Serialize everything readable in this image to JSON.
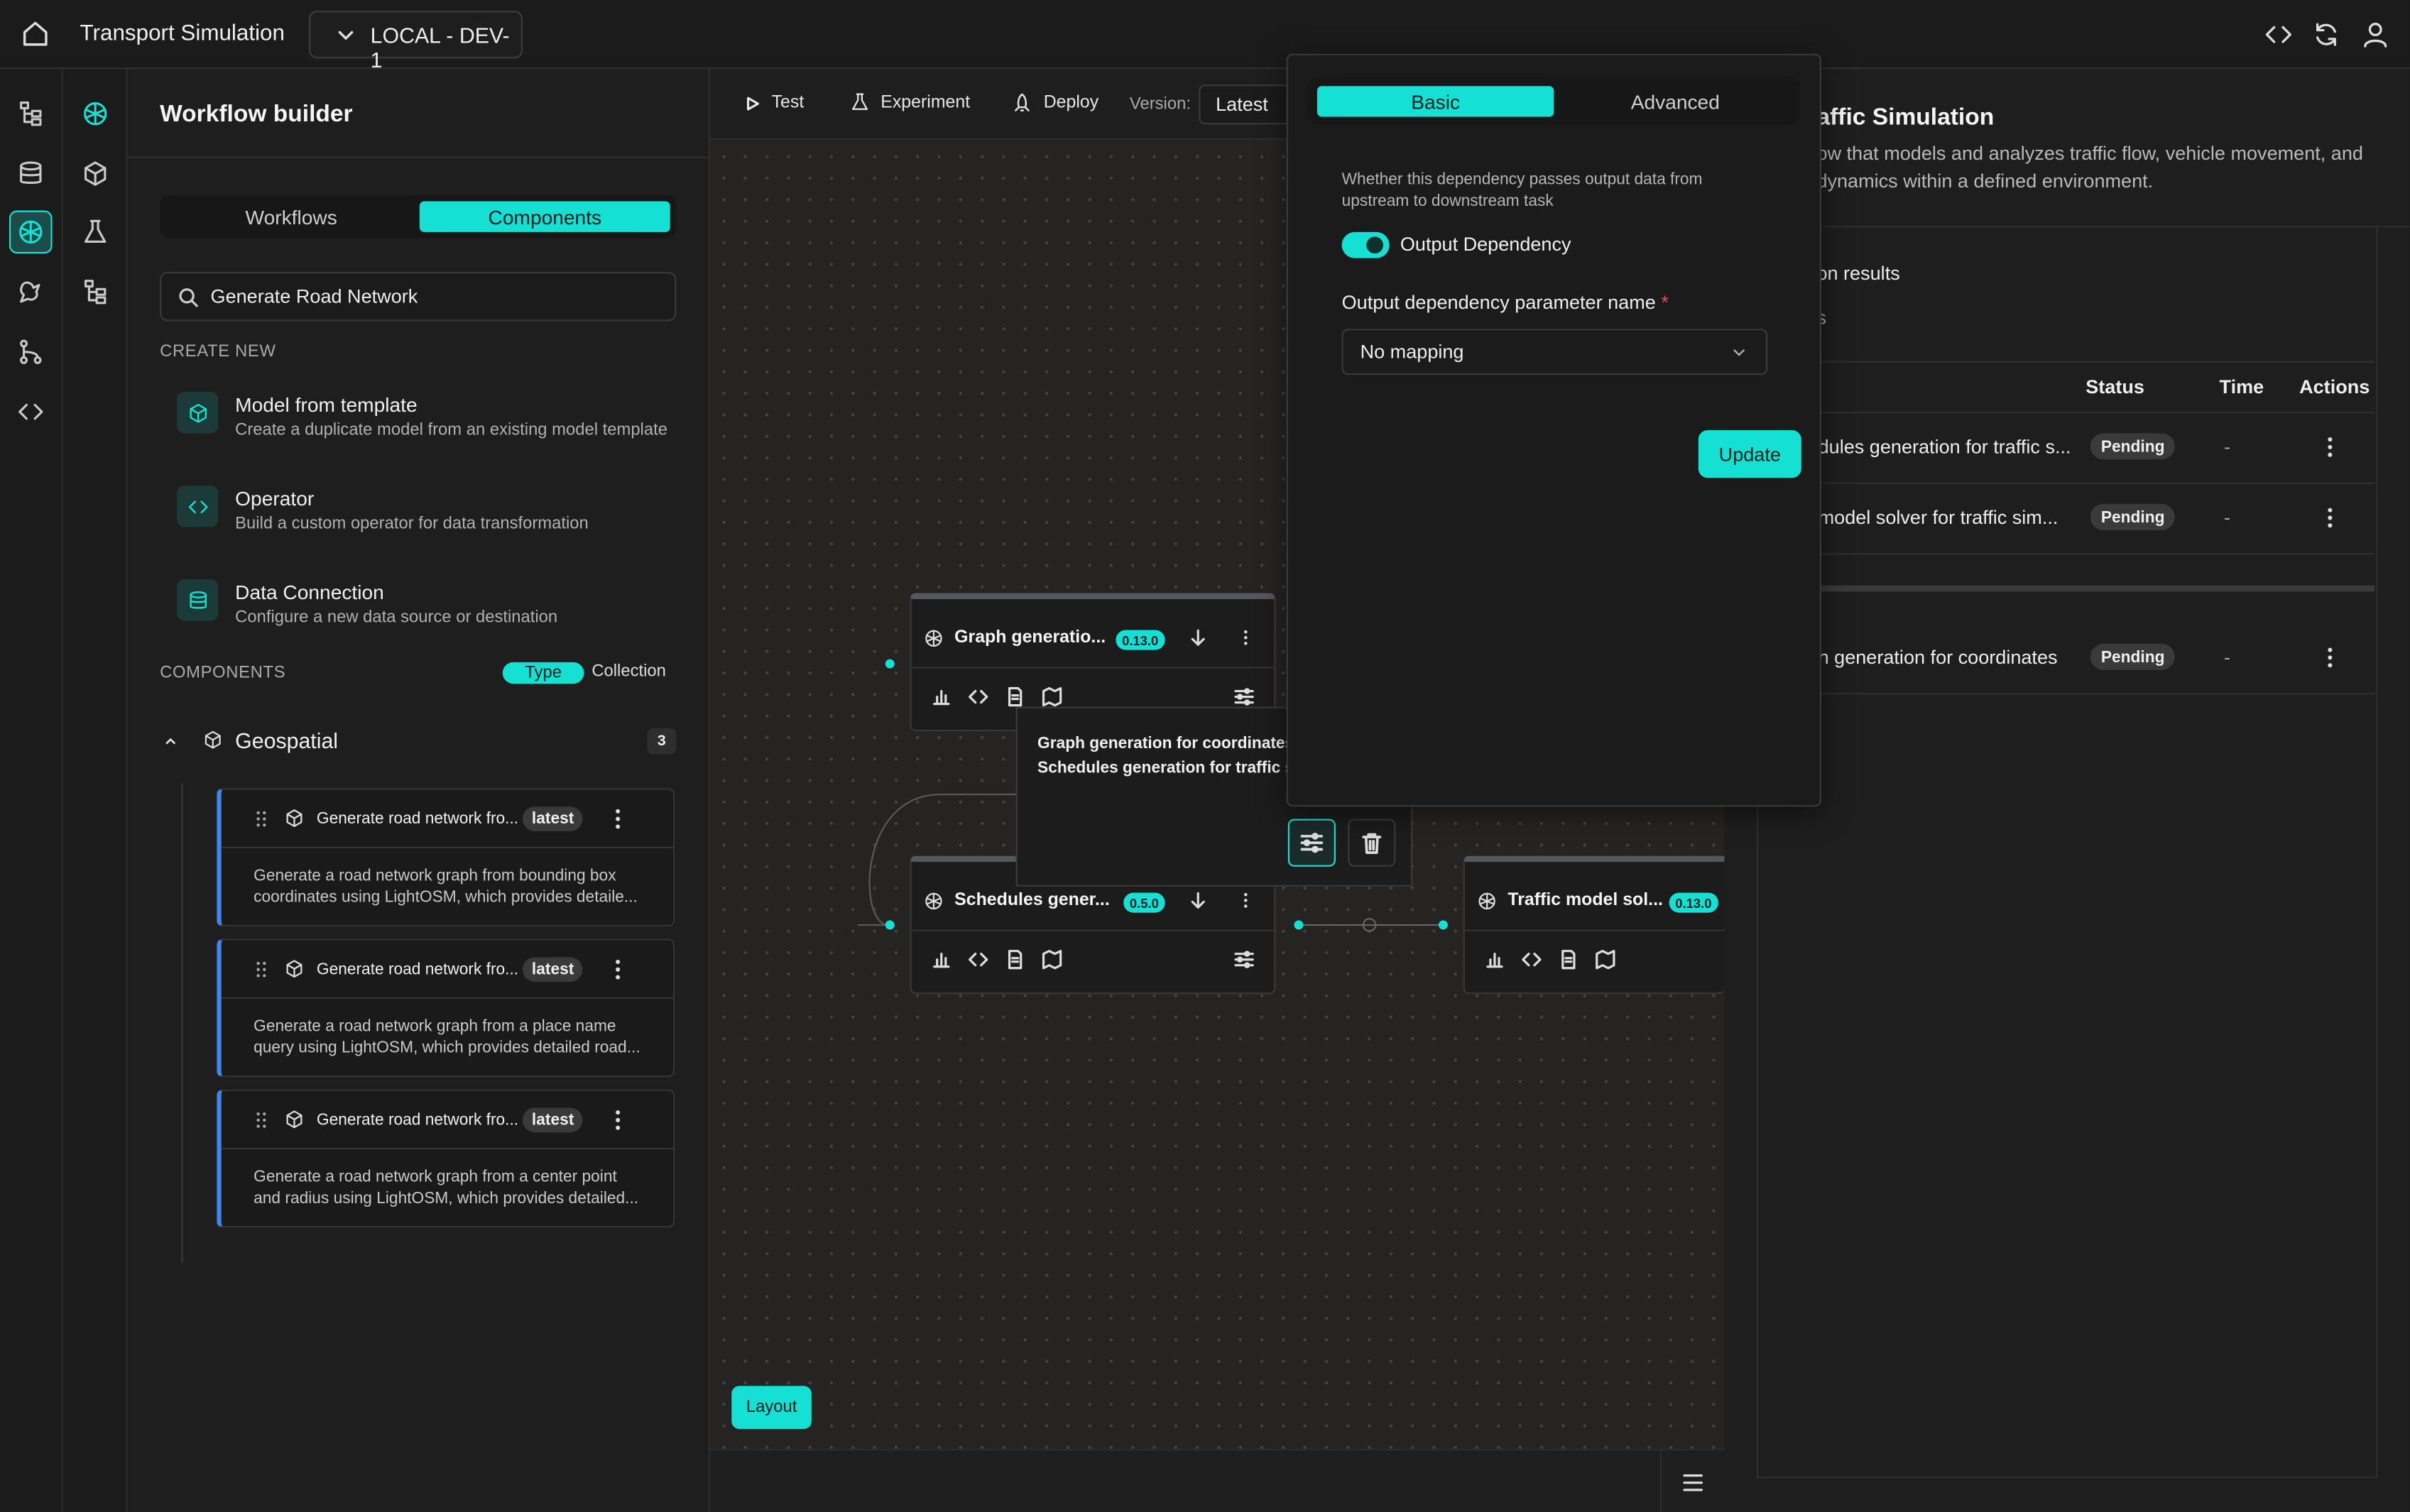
{
  "header": {
    "app_title": "Transport Simulation",
    "environment": "LOCAL - DEV-1"
  },
  "left_panel": {
    "title": "Workflow builder",
    "tabs": [
      "Workflows",
      "Components"
    ],
    "active_tab": "Components",
    "search_value": "Generate Road Network",
    "create_new_label": "CREATE NEW",
    "create_items": [
      {
        "title": "Model from template",
        "subtitle": "Create a duplicate model from an existing model template",
        "icon": "cube-icon"
      },
      {
        "title": "Operator",
        "subtitle": "Build a custom operator for data transformation",
        "icon": "code-icon"
      },
      {
        "title": "Data Connection",
        "subtitle": "Configure a new data source or destination",
        "icon": "database-icon"
      }
    ],
    "components_label": "COMPONENTS",
    "grouping_toggle": [
      "Type",
      "Collection"
    ],
    "group": {
      "name": "Geospatial",
      "count": "3"
    },
    "cards": [
      {
        "title": "Generate road network fro...",
        "badge": "latest",
        "desc1": "Generate a road network graph from bounding box",
        "desc2": "coordinates using LightOSM, which provides detaile..."
      },
      {
        "title": "Generate road network fro...",
        "badge": "latest",
        "desc1": "Generate a road network graph from a place name",
        "desc2": "query using LightOSM, which provides detailed road..."
      },
      {
        "title": "Generate road network fro...",
        "badge": "latest",
        "desc1": "Generate a road network graph from a center point",
        "desc2": "and radius using LightOSM, which provides detailed..."
      }
    ]
  },
  "canvas": {
    "toolbar": {
      "test": "Test",
      "experiment": "Experiment",
      "deploy": "Deploy",
      "version_label": "Version:",
      "version_value": "Latest"
    },
    "nodes": [
      {
        "title": "Graph generatio...",
        "version": "0.13.0"
      },
      {
        "title": "Schedules gener...",
        "version": "0.5.0"
      },
      {
        "title": "Traffic model sol...",
        "version": "0.13.0"
      }
    ],
    "tooltip_lines": [
      "Graph generation for coordinates",
      "Schedules generation for traffic s"
    ],
    "layout_button": "Layout"
  },
  "popover": {
    "tabs": [
      "Basic",
      "Advanced"
    ],
    "active_tab": "Basic",
    "help_text_1": "Whether this dependency passes output data from",
    "help_text_2": "upstream to downstream task",
    "toggle_label": "Output Dependency",
    "toggle_on": true,
    "param_label": "Output dependency parameter name",
    "required_mark": "*",
    "select_value": "No mapping",
    "update_button": "Update"
  },
  "right_panel": {
    "title": "affic Simulation",
    "desc_1": "ow that models and analyzes traffic flow, vehicle movement, and",
    "desc_2": "dynamics within a defined environment.",
    "section_1": "on results",
    "section_2": "s",
    "columns": [
      "Status",
      "Time",
      "Actions"
    ],
    "rows": [
      {
        "name": "dules generation for traffic s...",
        "status": "Pending",
        "time": "-"
      },
      {
        "name": "model solver for traffic sim...",
        "status": "Pending",
        "time": "-"
      },
      {
        "name": "n generation for coordinates",
        "status": "Pending",
        "time": "-"
      }
    ]
  },
  "colors": {
    "accent": "#14e1d3",
    "card_accent": "#3f86e6",
    "background": "#1f1e1e"
  }
}
